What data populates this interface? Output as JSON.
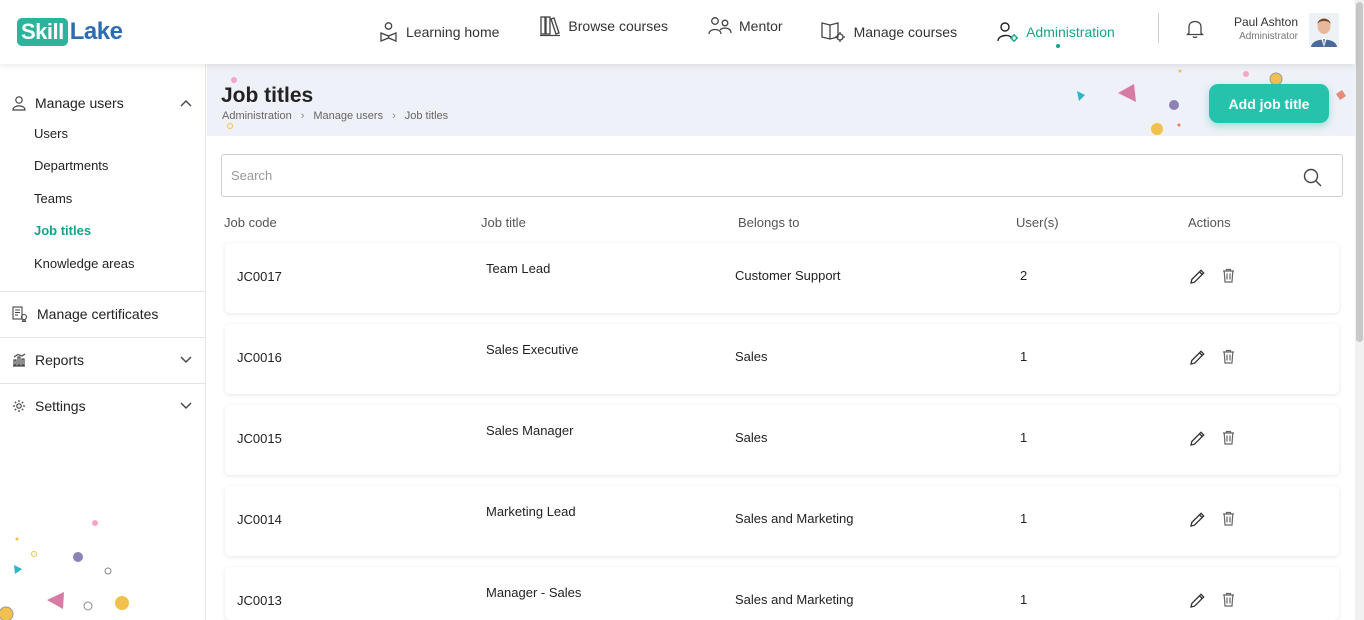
{
  "brand": {
    "part1": "Skill",
    "part2": "Lake"
  },
  "nav": {
    "items": [
      {
        "label": "Learning home",
        "icon": "learning-home-icon"
      },
      {
        "label": "Browse courses",
        "icon": "books-icon"
      },
      {
        "label": "Mentor",
        "icon": "mentor-icon"
      },
      {
        "label": "Manage courses",
        "icon": "manage-courses-icon"
      },
      {
        "label": "Administration",
        "icon": "admin-icon"
      }
    ],
    "active": "Administration"
  },
  "user": {
    "name": "Paul Ashton",
    "role": "Administrator"
  },
  "sidebar": {
    "manage_users": "Manage users",
    "sub_items": [
      "Users",
      "Departments",
      "Teams",
      "Job titles",
      "Knowledge areas"
    ],
    "manage_certificates": "Manage certificates",
    "reports": "Reports",
    "settings": "Settings"
  },
  "page": {
    "title": "Job titles",
    "breadcrumb": [
      "Administration",
      "Manage users",
      "Job titles"
    ],
    "add_button": "Add job title"
  },
  "search": {
    "placeholder": "Search"
  },
  "table": {
    "headers": [
      "Job code",
      "Job title",
      "Belongs to",
      "User(s)",
      "Actions"
    ],
    "rows": [
      {
        "code": "JC0017",
        "title": "Team Lead",
        "belongs": "Customer Support",
        "users": "2"
      },
      {
        "code": "JC0016",
        "title": "Sales Executive",
        "belongs": "Sales",
        "users": "1"
      },
      {
        "code": "JC0015",
        "title": "Sales Manager",
        "belongs": "Sales",
        "users": "1"
      },
      {
        "code": "JC0014",
        "title": "Marketing Lead",
        "belongs": "Sales and Marketing",
        "users": "1"
      },
      {
        "code": "JC0013",
        "title": "Manager - Sales",
        "belongs": "Sales and Marketing",
        "users": "1"
      }
    ]
  },
  "colors": {
    "accent": "#13a58a",
    "button": "#26c2ab",
    "brand_blue": "#2d6cb0",
    "banner": "#eef1f7"
  }
}
